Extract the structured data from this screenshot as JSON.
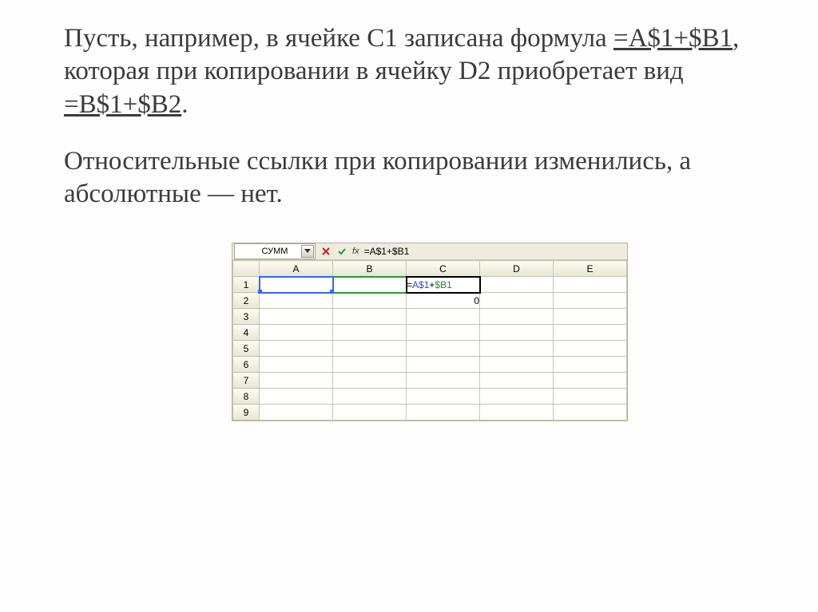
{
  "paragraph1_prefix": " Пусть, например, в ячейке С1 записана формула ",
  "formula1": "=А$1+$В1",
  "paragraph1_mid": ", которая при копировании в ячейку D2 приобретает вид ",
  "formula2": "=В$1+$В2",
  "paragraph1_suffix": ".",
  "paragraph2": " Относительные ссылки при копировании изменились, а абсолютные — нет.",
  "namebox": "СУММ",
  "fx_label": "fx",
  "formula_bar": "=A$1+$B1",
  "columns": [
    "A",
    "B",
    "C",
    "D",
    "E"
  ],
  "rows": [
    "1",
    "2",
    "3",
    "4",
    "5",
    "6",
    "7",
    "8",
    "9"
  ],
  "cell_c1_edit_eq": "=",
  "cell_c1_edit_a": "A$1",
  "cell_c1_edit_plus": "+",
  "cell_c1_edit_b": "$B1",
  "cell_c2_value": "0"
}
